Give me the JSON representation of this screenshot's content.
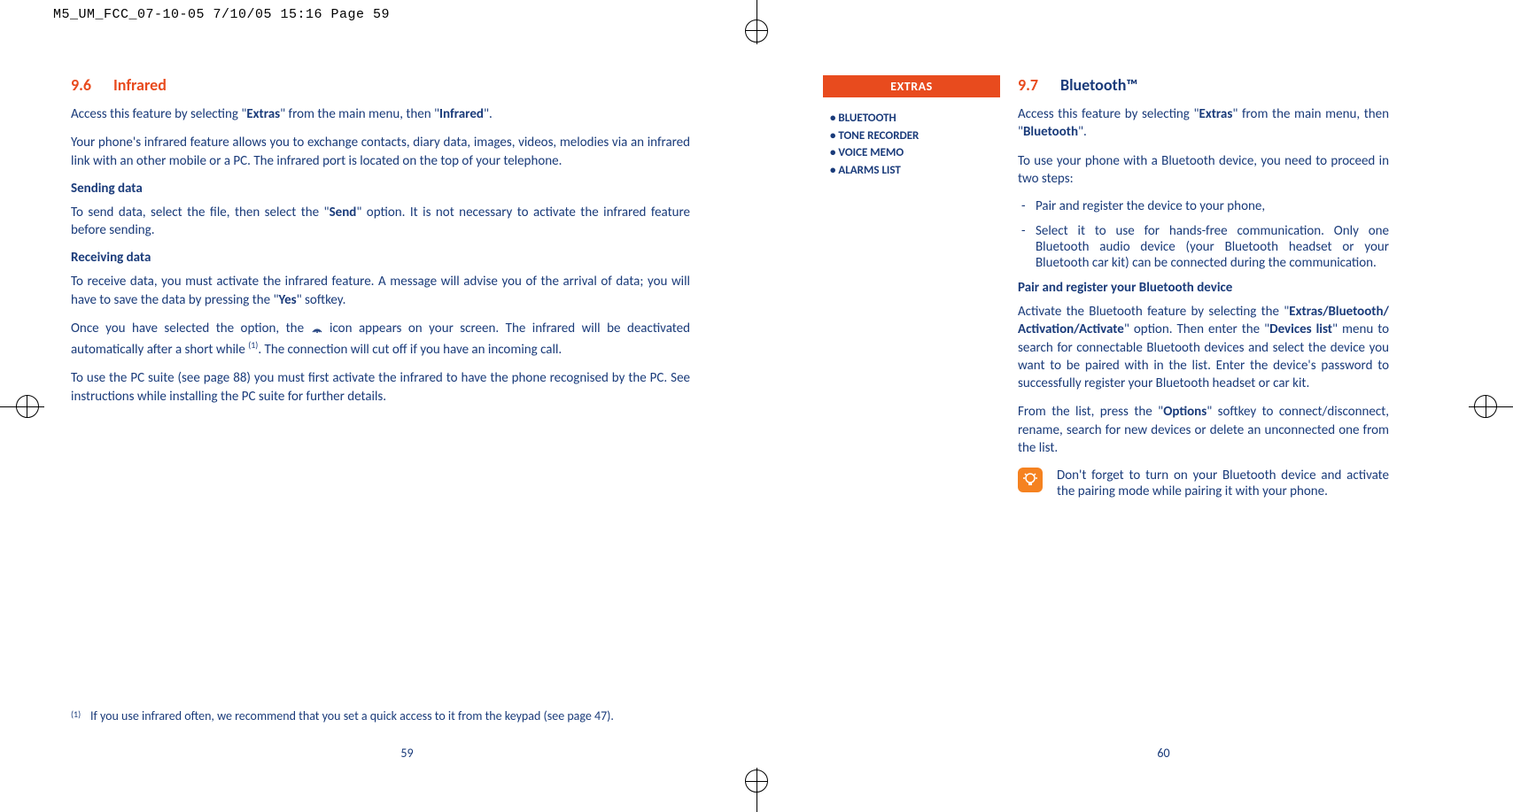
{
  "slug": "M5_UM_FCC_07-10-05  7/10/05  15:16  Page 59",
  "left_page": {
    "heading_num": "9.6",
    "heading": "Infrared",
    "p1_a": "Access this feature by selecting \"",
    "p1_b": "Extras",
    "p1_c": "\" from the main menu, then \"",
    "p1_d": "Infrared",
    "p1_e": "\".",
    "p2": "Your phone's infrared feature allows you to exchange contacts, diary data, images, videos, melodies via an infrared link with an other mobile or a PC. The infrared port is located on the top of your telephone.",
    "sub1": "Sending data",
    "p3_a": "To send data, select the file, then select the \"",
    "p3_b": "Send",
    "p3_c": "\" option. It is not necessary to activate the infrared feature before sending.",
    "sub2": "Receiving data",
    "p4_a": "To receive data, you must activate the infrared feature. A message will advise you of the arrival of data; you will have to save the data by pressing the \"",
    "p4_b": "Yes",
    "p4_c": "\" softkey.",
    "p5_a": "Once you have selected the option, the ",
    "p5_b": " icon appears on your screen. The infrared will be deactivated automatically after a short while ",
    "p5_sup": "(1)",
    "p5_c": ". The connection will cut off if you have an incoming call.",
    "p6": "To use the PC suite (see page 88) you must first activate the infrared to have the phone recognised by the PC. See instructions while installing the PC suite for further details.",
    "footnote_marker": "(1)",
    "footnote": "If you use infrared often, we recommend that you set a quick access to it from the keypad (see page 47).",
    "page_num": "59"
  },
  "right_page": {
    "extras_title": "EXTRAS",
    "extras_items": [
      "BLUETOOTH",
      "TONE RECORDER",
      "VOICE MEMO",
      "ALARMS LIST"
    ],
    "heading_num": "9.7",
    "heading": "Bluetooth™",
    "p1_a": "Access this feature by selecting \"",
    "p1_b": "Extras",
    "p1_c": "\" from the main menu, then \"",
    "p1_d": "Bluetooth",
    "p1_e": "\".",
    "p2": "To use your phone with a Bluetooth device, you need to proceed in two steps:",
    "b1": "Pair and register the device to your phone,",
    "b2": "Select it to use for hands-free communication. Only one Bluetooth audio device (your Bluetooth headset or your Bluetooth car kit) can be connected during the communication.",
    "sub1": "Pair and register your Bluetooth device",
    "p3_a": "Activate the Bluetooth feature by selecting the \"",
    "p3_b": "Extras/Bluetooth/ Activation/Activate",
    "p3_c": "\" option. Then enter the \"",
    "p3_d": "Devices list",
    "p3_e": "\" menu to search for connectable Bluetooth devices and select the device you want to be paired with in the list. Enter the device's password to successfully register your Bluetooth headset or car kit.",
    "p4_a": "From the list, press the \"",
    "p4_b": "Options",
    "p4_c": "\" softkey to connect/disconnect, rename, search for new devices or delete an unconnected one from the list.",
    "tip": "Don't forget to turn on your Bluetooth device and activate the pairing mode while pairing it with your phone.",
    "page_num": "60"
  }
}
